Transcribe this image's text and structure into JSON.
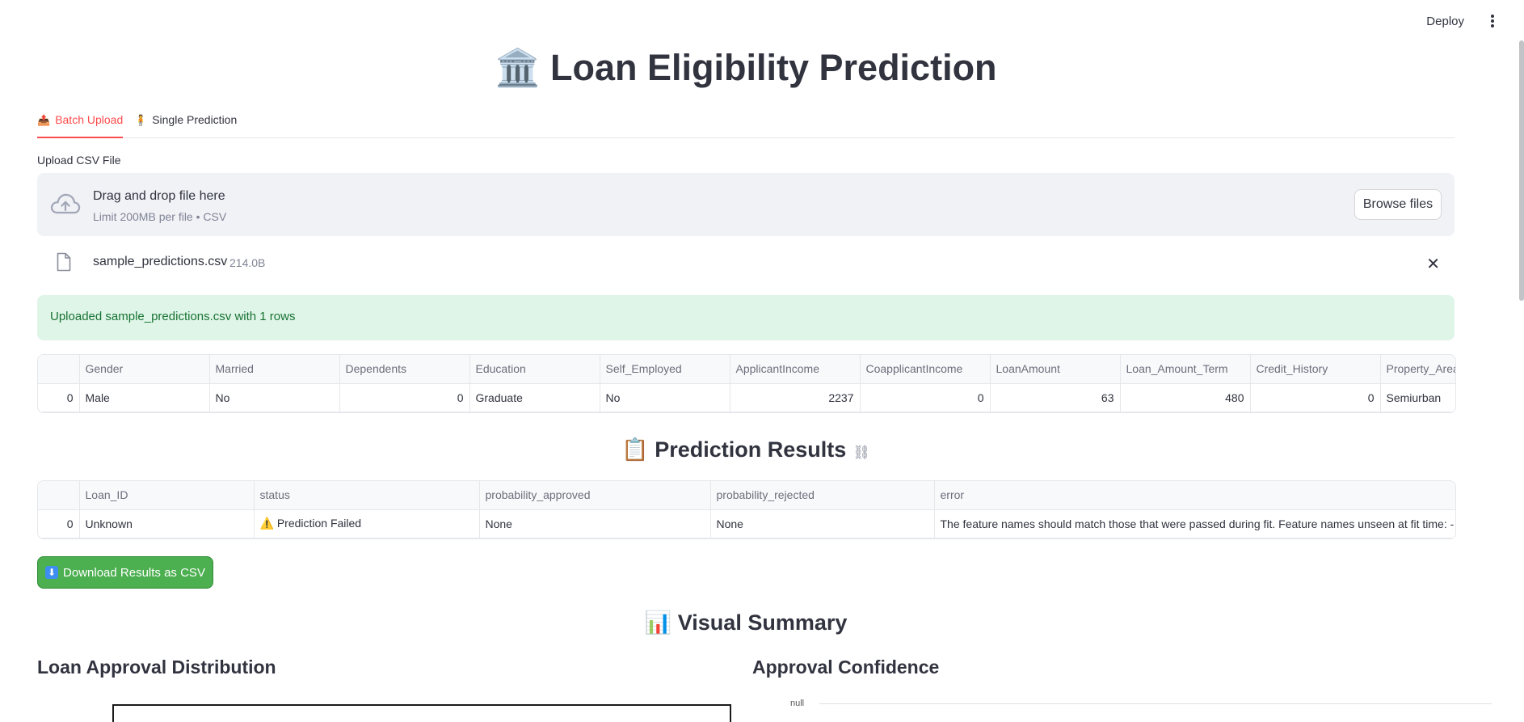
{
  "topbar": {
    "deploy_label": "Deploy",
    "menu_icon": "kebab-menu-icon"
  },
  "title": {
    "emoji": "🏛️",
    "text": "Loan Eligibility Prediction"
  },
  "tabs": [
    {
      "emoji": "📤",
      "label": "Batch Upload",
      "active": true
    },
    {
      "emoji": "🧍",
      "label": "Single Prediction",
      "active": false
    }
  ],
  "uploader": {
    "label": "Upload CSV File",
    "drop_title": "Drag and drop file here",
    "drop_sub": "Limit 200MB per file • CSV",
    "browse_label": "Browse files",
    "file_name": "sample_predictions.csv",
    "file_size": "214.0B"
  },
  "success_message": "Uploaded sample_predictions.csv with 1 rows",
  "input_table": {
    "columns": [
      "",
      "Gender",
      "Married",
      "Dependents",
      "Education",
      "Self_Employed",
      "ApplicantIncome",
      "CoapplicantIncome",
      "LoanAmount",
      "Loan_Amount_Term",
      "Credit_History",
      "Property_Area"
    ],
    "rows": [
      [
        "0",
        "Male",
        "No",
        "0",
        "Graduate",
        "No",
        "2237",
        "0",
        "63",
        "480",
        "0",
        "Semiurban"
      ]
    ]
  },
  "results_heading": {
    "emoji": "📋",
    "text": "Prediction Results"
  },
  "results_table": {
    "columns": [
      "",
      "Loan_ID",
      "status",
      "probability_approved",
      "probability_rejected",
      "error"
    ],
    "rows": [
      [
        "0",
        "Unknown",
        "⚠️ Prediction Failed",
        "None",
        "None",
        "The feature names should match those that were passed during fit. Feature names unseen at fit time: - Credit_"
      ]
    ]
  },
  "download_button": {
    "icon": "⬇",
    "label": "Download Results as CSV"
  },
  "visual_heading": {
    "emoji": "📊",
    "text": "Visual Summary"
  },
  "charts": {
    "left_title": "Loan Approval Distribution",
    "right_title": "Approval Confidence",
    "right_axis_label": "null"
  }
}
